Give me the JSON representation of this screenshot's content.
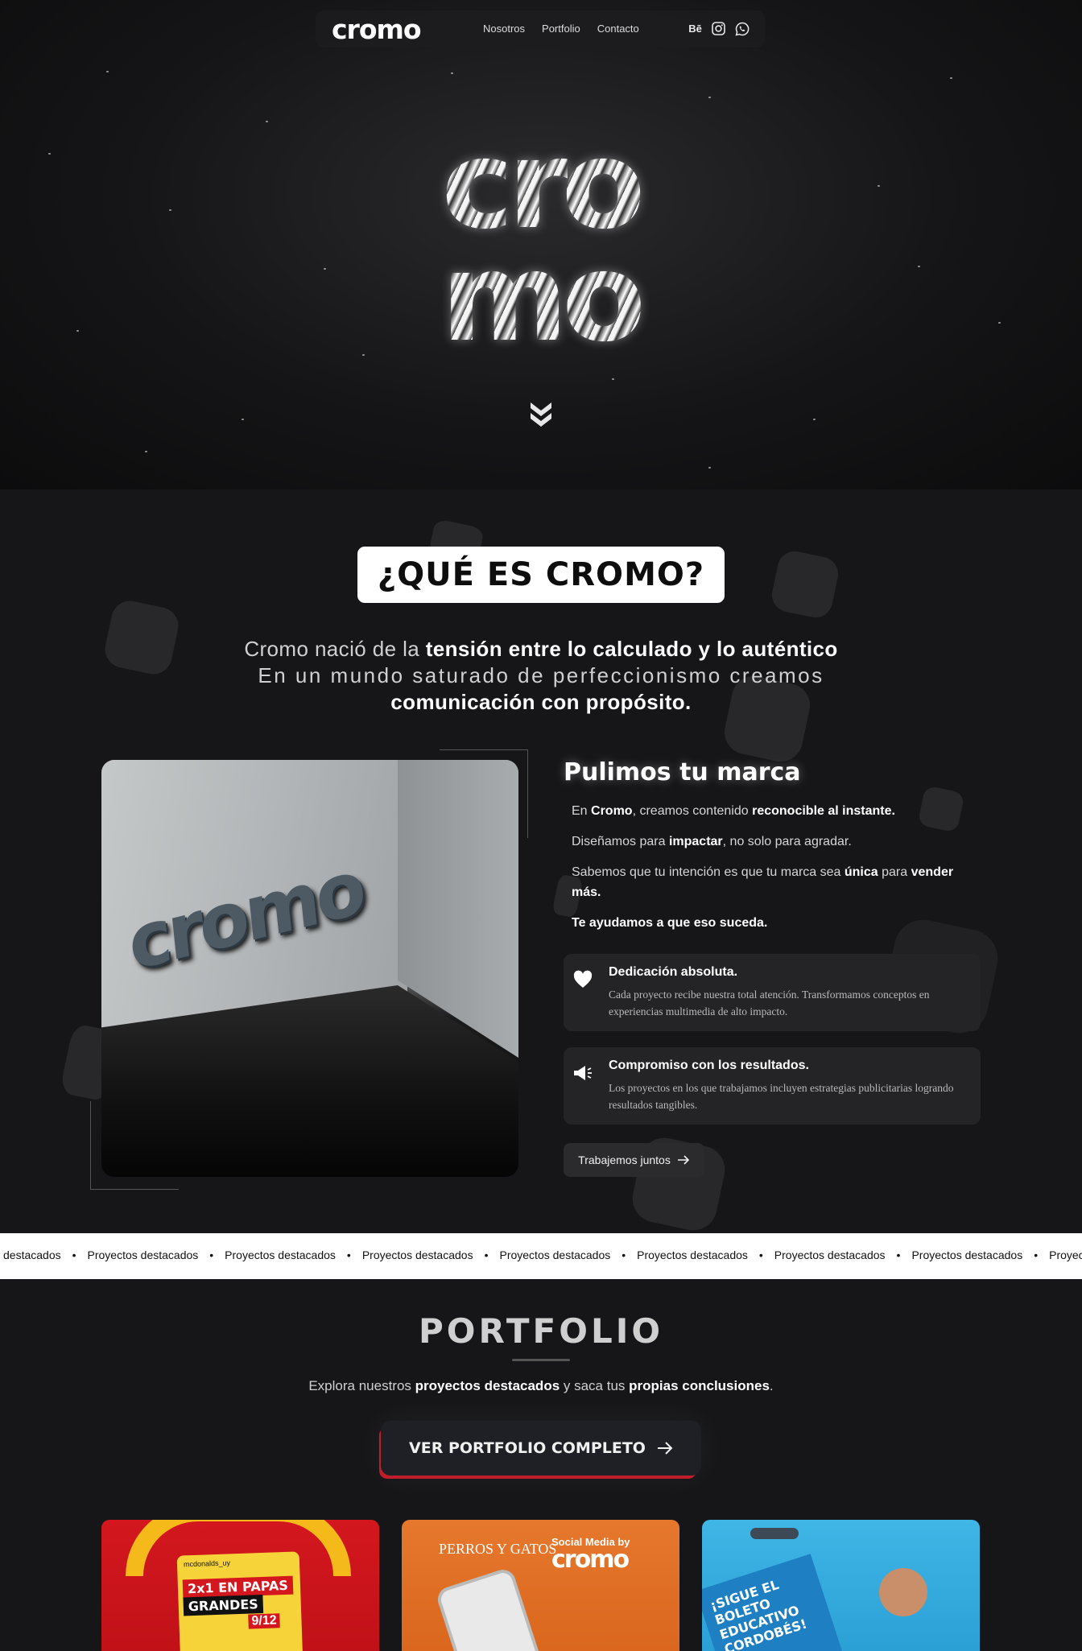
{
  "nav": {
    "logo": "cromo",
    "links": [
      "Nosotros",
      "Portfolio",
      "Contacto"
    ],
    "social": [
      {
        "name": "behance-icon",
        "glyph": "Bē"
      },
      {
        "name": "instagram-icon",
        "glyph": ""
      },
      {
        "name": "whatsapp-icon",
        "glyph": ""
      }
    ]
  },
  "hero": {
    "logo_line1": "cro",
    "logo_line2": "mo",
    "scroll_icon": "double-chevron-down-icon"
  },
  "about": {
    "title": "¿QUÉ ES CROMO?",
    "intro_plain1": "Cromo nació de la ",
    "intro_bold1": "tensión entre lo calculado y lo auténtico",
    "intro_line2": "En un mundo saturado de perfeccionismo creamos",
    "intro_bold2": "comunicación con propósito.",
    "image_wall_text": "cromo",
    "heading": "Pulimos tu marca",
    "p1_a": "En ",
    "p1_b": "Cromo",
    "p1_c": ", creamos contenido ",
    "p1_d": "reconocible al instante.",
    "p2_a": "Diseñamos para ",
    "p2_b": "impactar",
    "p2_c": ", no solo para agradar.",
    "p3_a": "Sabemos que tu intención es que tu marca sea ",
    "p3_b": "única",
    "p3_c": " para ",
    "p3_d": "vender más.",
    "p4": "Te ayudamos a que eso suceda.",
    "features": [
      {
        "icon": "heart-icon",
        "title": "Dedicación absoluta.",
        "text": "Cada proyecto recibe nuestra total atención. Transformamos conceptos en experiencias multimedia de alto impacto."
      },
      {
        "icon": "megaphone-icon",
        "title": "Compromiso con los resultados.",
        "text": "Los proyectos en los que trabajamos incluyen estrategias publicitarias logrando resultados tangibles."
      }
    ],
    "cta": "Trabajemos juntos"
  },
  "marquee": {
    "items": [
      "destacados",
      "Proyectos destacados",
      "Proyectos destacados",
      "Proyectos destacados",
      "Proyectos destacados",
      "Proyectos destacados",
      "Proyectos destacados",
      "Proyectos destacados",
      "Proyecto"
    ]
  },
  "portfolio": {
    "title": "PORTFOLIO",
    "sub_a": "Explora nuestros ",
    "sub_b": "proyectos destacados",
    "sub_c": " y saca tus ",
    "sub_d": "propias conclusiones",
    "sub_e": ".",
    "button": "VER PORTFOLIO COMPLETO",
    "cards": [
      {
        "handle": "mcdonalds_uy",
        "promo1": "2x1 EN PAPAS",
        "promo2": "GRANDES",
        "date": "9/12"
      },
      {
        "brand": "PERROS Y GATOS",
        "label": "Social Media by",
        "label2": "cromo"
      },
      {
        "sign": "¡SIGUE EL BOLETO EDUCATIVO CORDOBÉS!"
      }
    ]
  },
  "colors": {
    "accent_red": "#c01d2a",
    "bg": "#161618",
    "white_band": "#ffffff"
  }
}
